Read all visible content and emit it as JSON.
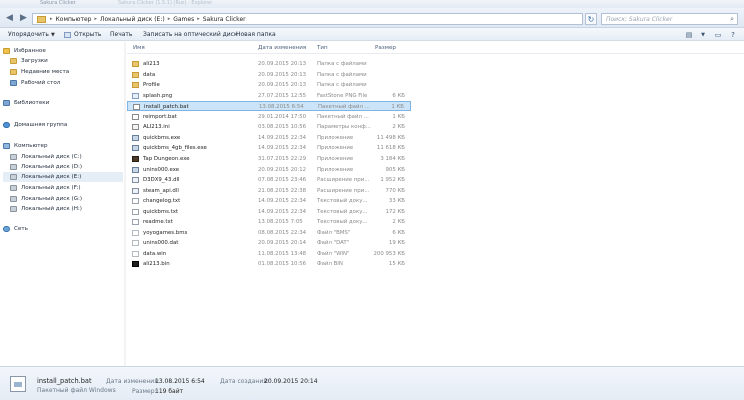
{
  "titlebar": {
    "title": "Sakura Clicker",
    "title_extra": "Sakura Clicker (1.5.1) (Rus) - Explorer"
  },
  "address": {
    "crumbs": [
      "Компьютер",
      "Локальный диск (E:)",
      "Games",
      "Sakura Clicker"
    ],
    "search_placeholder": "Поиск: Sakura Clicker"
  },
  "toolbar": {
    "organize": "Упорядочить",
    "open": "Открыть",
    "print": "Печать",
    "burn": "Записать на оптический диск",
    "new_folder": "Новая папка"
  },
  "nav": {
    "favorites": "Избранное",
    "downloads": "Загрузки",
    "recent": "Недавние места",
    "desktop": "Рабочий стол",
    "libraries": "Библиотеки",
    "homegroup": "Домашняя группа",
    "computer": "Компьютер",
    "drives": [
      "Локальный диск (C:)",
      "Локальный диск (D:)",
      "Локальный диск (E:)",
      "Локальный диск (F:)",
      "Локальный диск (G:)",
      "Локальный диск (H:)"
    ],
    "network": "Сеть"
  },
  "columns": {
    "name": "Имя",
    "date": "Дата изменения",
    "type": "Тип",
    "size": "Размер"
  },
  "files": [
    {
      "name": "ali213",
      "date": "20.09.2015 20:13",
      "type": "Папка с файлами",
      "size": "",
      "icon": "folder"
    },
    {
      "name": "data",
      "date": "20.09.2015 20:13",
      "type": "Папка с файлами",
      "size": "",
      "icon": "folder"
    },
    {
      "name": "Profile",
      "date": "20.09.2015 20:13",
      "type": "Папка с файлами",
      "size": "",
      "icon": "folder"
    },
    {
      "name": "splash.png",
      "date": "27.07.2015 12:55",
      "type": "FastStone PNG File",
      "size": "6 КБ",
      "icon": "png"
    },
    {
      "name": "install_patch.bat",
      "date": "13.08.2015 6:54",
      "type": "Пакетный файл ...",
      "size": "1 КБ",
      "icon": "bat"
    },
    {
      "name": "reimport.bat",
      "date": "29.01.2014 17:50",
      "type": "Пакетный файл ...",
      "size": "1 КБ",
      "icon": "bat"
    },
    {
      "name": "ALI213.ini",
      "date": "03.08.2015 10:56",
      "type": "Параметры конф...",
      "size": "2 КБ",
      "icon": "ini"
    },
    {
      "name": "quickbms.exe",
      "date": "14.09.2015 22:34",
      "type": "Приложение",
      "size": "11 498 КБ",
      "icon": "exe"
    },
    {
      "name": "quickbms_4gb_files.exe",
      "date": "14.09.2015 22:34",
      "type": "Приложение",
      "size": "11 618 КБ",
      "icon": "exe"
    },
    {
      "name": "Tap Dungeon.exe",
      "date": "31.07.2015 22:29",
      "type": "Приложение",
      "size": "3 184 КБ",
      "icon": "tap"
    },
    {
      "name": "unins000.exe",
      "date": "20.09.2015 20:12",
      "type": "Приложение",
      "size": "905 КБ",
      "icon": "exe"
    },
    {
      "name": "D3DX9_43.dll",
      "date": "07.08.2015 23:46",
      "type": "Расширение при...",
      "size": "1 952 КБ",
      "icon": "dll"
    },
    {
      "name": "steam_api.dll",
      "date": "21.08.2015 22:38",
      "type": "Расширение при...",
      "size": "770 КБ",
      "icon": "dll"
    },
    {
      "name": "changelog.txt",
      "date": "14.09.2015 22:34",
      "type": "Текстовый доку...",
      "size": "33 КБ",
      "icon": "txt"
    },
    {
      "name": "quickbms.txt",
      "date": "14.09.2015 22:34",
      "type": "Текстовый доку...",
      "size": "172 КБ",
      "icon": "txt"
    },
    {
      "name": "readme.txt",
      "date": "13.08.2015 7:05",
      "type": "Текстовый доку...",
      "size": "2 КБ",
      "icon": "txt"
    },
    {
      "name": "yoyogames.bms",
      "date": "08.08.2015 22:34",
      "type": "Файл \"BMS\"",
      "size": "6 КБ",
      "icon": "bms"
    },
    {
      "name": "unins000.dat",
      "date": "20.09.2015 20:14",
      "type": "Файл \"DAT\"",
      "size": "19 КБ",
      "icon": "dat"
    },
    {
      "name": "data.win",
      "date": "11.08.2015 13:48",
      "type": "Файл \"WIN\"",
      "size": "200 953 КБ",
      "icon": "dat"
    },
    {
      "name": "ali213.bin",
      "date": "01.08.2015 10:56",
      "type": "Файл BIN",
      "size": "15 КБ",
      "icon": "bin"
    }
  ],
  "selected_index": 4,
  "details": {
    "name": "install_patch.bat",
    "type": "Пакетный файл Windows",
    "modified_label": "Дата изменения:",
    "modified_value": "13.08.2015 6:54",
    "created_label": "Дата создания:",
    "created_value": "20.09.2015 20:14",
    "size_label": "Размер:",
    "size_value": "119 байт"
  }
}
